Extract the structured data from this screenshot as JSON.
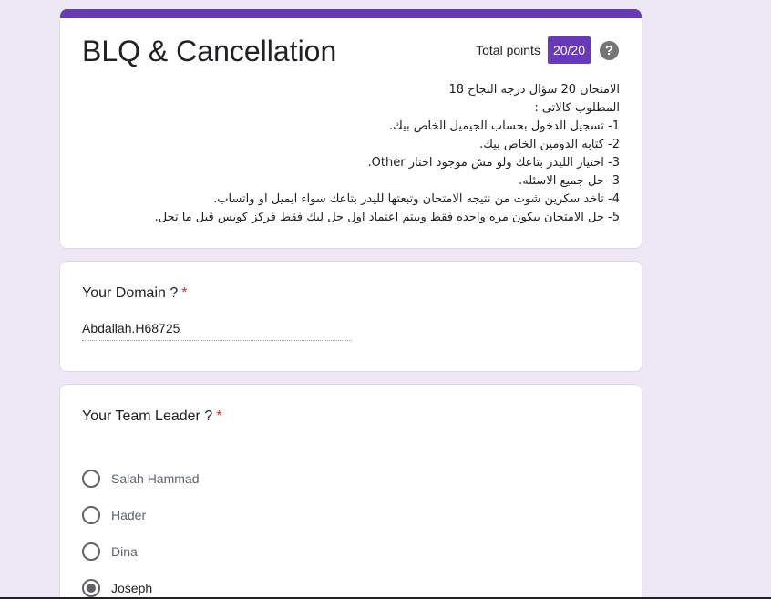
{
  "header": {
    "title": "BLQ & Cancellation",
    "points_label": "Total points",
    "points_value": "20/20",
    "help_icon": "?"
  },
  "description": [
    "الامتحان 20 سؤال درجه النجاح 18",
    "المطلوب كالاتى :",
    "1- تسجيل الدخول بحساب الجيميل الخاص بيك.",
    "2- كتابه الدومين الخاص بيك.",
    "3- اختيار الليدر بتاعك ولو مش موجود اختار Other.",
    "3- حل جميع الاسئله.",
    "4- تاخد سكرين شوت من نتيجه الامتحان وتبعتها لليدر بتاعك سواء ايميل او واتساب.",
    "5- حل الامتحان بيكون مره واحده فقط وبيتم اعتماد اول حل ليك فقط فركز كويس قبل ما تحل."
  ],
  "questions": {
    "domain": {
      "title": "Your Domain ?",
      "required": "*",
      "answer": "Abdallah.H68725"
    },
    "leader": {
      "title": "Your Team Leader ?",
      "required": "*",
      "options": [
        "Salah Hammad",
        "Hader",
        "Dina",
        "Joseph"
      ],
      "selected": "Joseph"
    }
  },
  "colors": {
    "accent": "#673ab7",
    "background": "#ede7f6",
    "required": "#d93025"
  }
}
